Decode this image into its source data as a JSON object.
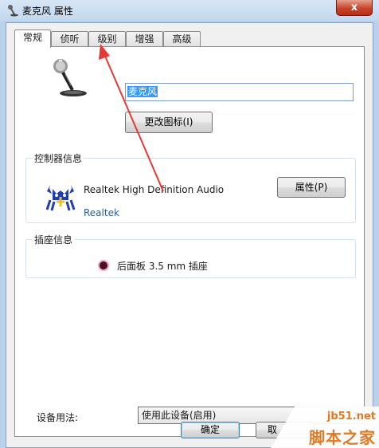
{
  "window": {
    "title": "麦克风 属性",
    "close_label": "x"
  },
  "tabs": [
    {
      "label": "常规",
      "active": true
    },
    {
      "label": "侦听",
      "active": false
    },
    {
      "label": "级别",
      "active": false
    },
    {
      "label": "增强",
      "active": false
    },
    {
      "label": "高级",
      "active": false
    }
  ],
  "general": {
    "device_name": "麦克风",
    "change_icon_label": "更改图标(I)",
    "controller": {
      "group_title": "控制器信息",
      "driver_name": "Realtek High Definition Audio",
      "vendor": "Realtek",
      "properties_label": "属性(P)"
    },
    "jack": {
      "group_title": "插座信息",
      "description": "后面板 3.5 mm 插座"
    },
    "usage": {
      "label": "设备用法:",
      "selected": "使用此设备(启用)"
    }
  },
  "footer": {
    "ok_label": "确定",
    "cancel_label_partial": "取"
  },
  "watermark": {
    "url": "jb51.net",
    "text": "脚本之家"
  },
  "colors": {
    "annotation_arrow": "#e53935",
    "selection": "#3399ff",
    "watermark": "#e07a24"
  }
}
